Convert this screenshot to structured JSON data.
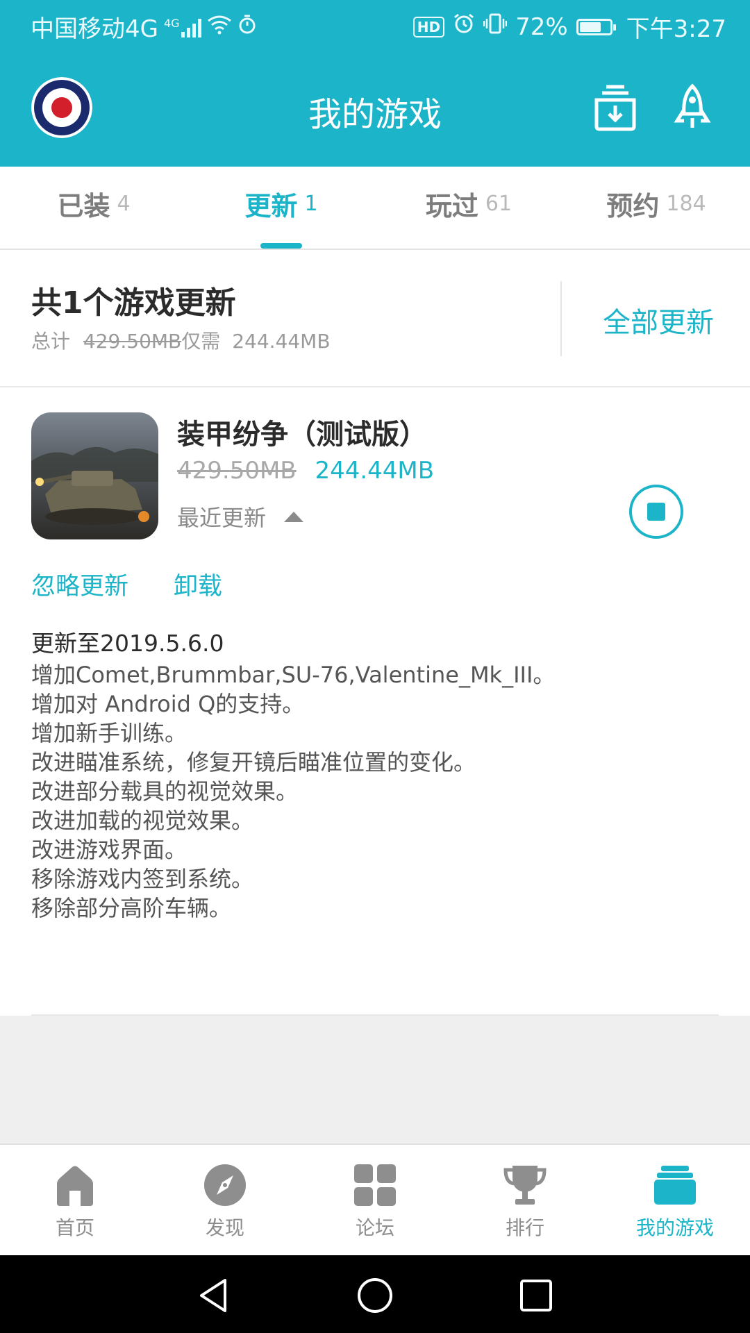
{
  "status_bar": {
    "carrier": "中国移动4G",
    "network_badge": "4G",
    "hd_badge": "HD",
    "battery_level": 0.72,
    "battery": "72%",
    "time": "下午3:27",
    "icons": [
      "signal-icon",
      "wifi-icon",
      "stopwatch-icon",
      "hd-icon",
      "alarm-icon",
      "vibrate-icon",
      "battery-icon"
    ]
  },
  "header": {
    "title": "我的游戏",
    "icons": [
      "avatar-roundel",
      "download-box-icon",
      "rocket-icon"
    ]
  },
  "tabs": [
    {
      "label": "已装",
      "count": "4",
      "active": false
    },
    {
      "label": "更新",
      "count": "1",
      "active": true
    },
    {
      "label": "玩过",
      "count": "61",
      "active": false
    },
    {
      "label": "预约",
      "count": "184",
      "active": false
    }
  ],
  "summary": {
    "title": "共1个游戏更新",
    "prefix": "总计",
    "total_size": "429.50MB",
    "only_need_label": "仅需",
    "need_size": "244.44MB",
    "update_all_label": "全部更新"
  },
  "game": {
    "name": "装甲纷争（测试版）",
    "old_size": "429.50MB",
    "new_size": "244.44MB",
    "recent_label": "最近更新",
    "ignore_label": "忽略更新",
    "uninstall_label": "卸载",
    "notes_title": "更新至2019.5.6.0",
    "notes": [
      "增加Comet,Brummbar,SU-76,Valentine_Mk_III。",
      "增加对 Android Q的支持。",
      "增加新手训练。",
      "改进瞄准系统，修复开镜后瞄准位置的变化。",
      "改进部分载具的视觉效果。",
      "改进加载的视觉效果。",
      "改进游戏界面。",
      "移除游戏内签到系统。",
      "移除部分高阶车辆。"
    ]
  },
  "bottom_nav": [
    {
      "label": "首页",
      "icon": "home-icon",
      "active": false
    },
    {
      "label": "发现",
      "icon": "compass-icon",
      "active": false
    },
    {
      "label": "论坛",
      "icon": "grid-icon",
      "active": false
    },
    {
      "label": "排行",
      "icon": "trophy-icon",
      "active": false
    },
    {
      "label": "我的游戏",
      "icon": "stack-icon",
      "active": true
    }
  ],
  "colors": {
    "accent": "#1bb4c8",
    "background": "#efefef",
    "text_gray": "#8e8e8e"
  }
}
